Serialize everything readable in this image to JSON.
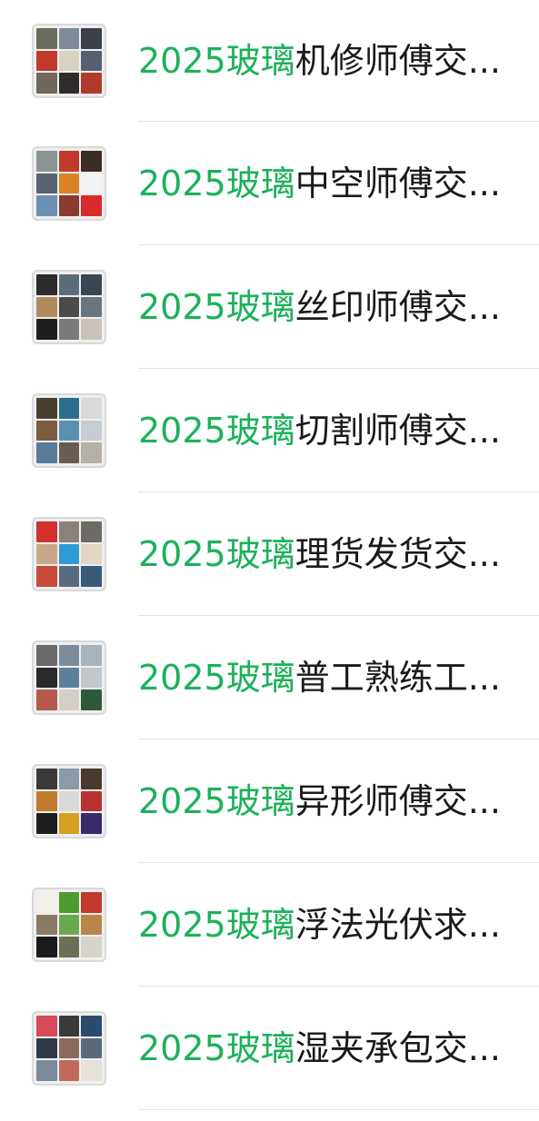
{
  "highlight_color": "#1bb15a",
  "text_color": "#1a1a1a",
  "groups": [
    {
      "highlight": "2025玻璃",
      "rest": "机修师傅交...",
      "avatar_icon": "group-avatar-icon",
      "tiles": [
        "#6b6b5e",
        "#7e8b96",
        "#3a3f48",
        "#c0392b",
        "#d8d2c4",
        "#566070",
        "#70685e",
        "#2e2b2a",
        "#b23a2c"
      ]
    },
    {
      "highlight": "2025玻璃",
      "rest": "中空师傅交...",
      "avatar_icon": "group-avatar-icon",
      "tiles": [
        "#8c9394",
        "#c0392b",
        "#3b2c26",
        "#5a6270",
        "#d98324",
        "#f2f2f2",
        "#6a8fb3",
        "#8a3a2e",
        "#d92b2b"
      ]
    },
    {
      "highlight": "2025玻璃",
      "rest": "丝印师傅交...",
      "avatar_icon": "group-avatar-icon",
      "tiles": [
        "#2b2b2b",
        "#5d6d78",
        "#3a4650",
        "#b08a5a",
        "#4a4a4a",
        "#6b7580",
        "#1e1e1e",
        "#7a7a7a",
        "#c8c2b8"
      ]
    },
    {
      "highlight": "2025玻璃",
      "rest": "切割师傅交...",
      "avatar_icon": "group-avatar-icon",
      "tiles": [
        "#4a4030",
        "#2c6e8f",
        "#d9d9d9",
        "#7a5c3e",
        "#5b8fb0",
        "#c6cdd2",
        "#5a7a9a",
        "#6a5d50",
        "#b5b0a8"
      ]
    },
    {
      "highlight": "2025玻璃",
      "rest": "理货发货交...",
      "avatar_icon": "group-avatar-icon",
      "tiles": [
        "#d32f2f",
        "#8a8178",
        "#6e6a66",
        "#c9a88a",
        "#2e9bd6",
        "#e3d6c4",
        "#c84a3a",
        "#5a6a80",
        "#3a5a7a"
      ]
    },
    {
      "highlight": "2025玻璃",
      "rest": "普工熟练工...",
      "avatar_icon": "group-avatar-icon",
      "tiles": [
        "#6a6a6a",
        "#7d8c98",
        "#a8b4bd",
        "#2a2a2a",
        "#5c7f9e",
        "#c2c7cc",
        "#b55a4a",
        "#d4d0c8",
        "#2e5a3a"
      ]
    },
    {
      "highlight": "2025玻璃",
      "rest": "异形师傅交...",
      "avatar_icon": "group-avatar-icon",
      "tiles": [
        "#3c3a38",
        "#8a9aa6",
        "#4a3a2e",
        "#c07a2e",
        "#d9d9d9",
        "#b83232",
        "#1e1e1e",
        "#d4a020",
        "#3a2a6a"
      ]
    },
    {
      "highlight": "2025玻璃",
      "rest": "浮法光伏求...",
      "avatar_icon": "group-avatar-icon",
      "tiles": [
        "#f2efe8",
        "#4f9a2e",
        "#c0392b",
        "#8a7a66",
        "#6aa84f",
        "#b8864a",
        "#1a1a1a",
        "#6b6f55",
        "#d8d4cc"
      ]
    },
    {
      "highlight": "2025玻璃",
      "rest": "湿夹承包交...",
      "avatar_icon": "group-avatar-icon",
      "tiles": [
        "#d64a5a",
        "#3a3a3a",
        "#2c4a6e",
        "#2e3a4a",
        "#8a6a5a",
        "#5a6a7a",
        "#7a8a98",
        "#c26a5a",
        "#e6e2da"
      ]
    }
  ]
}
